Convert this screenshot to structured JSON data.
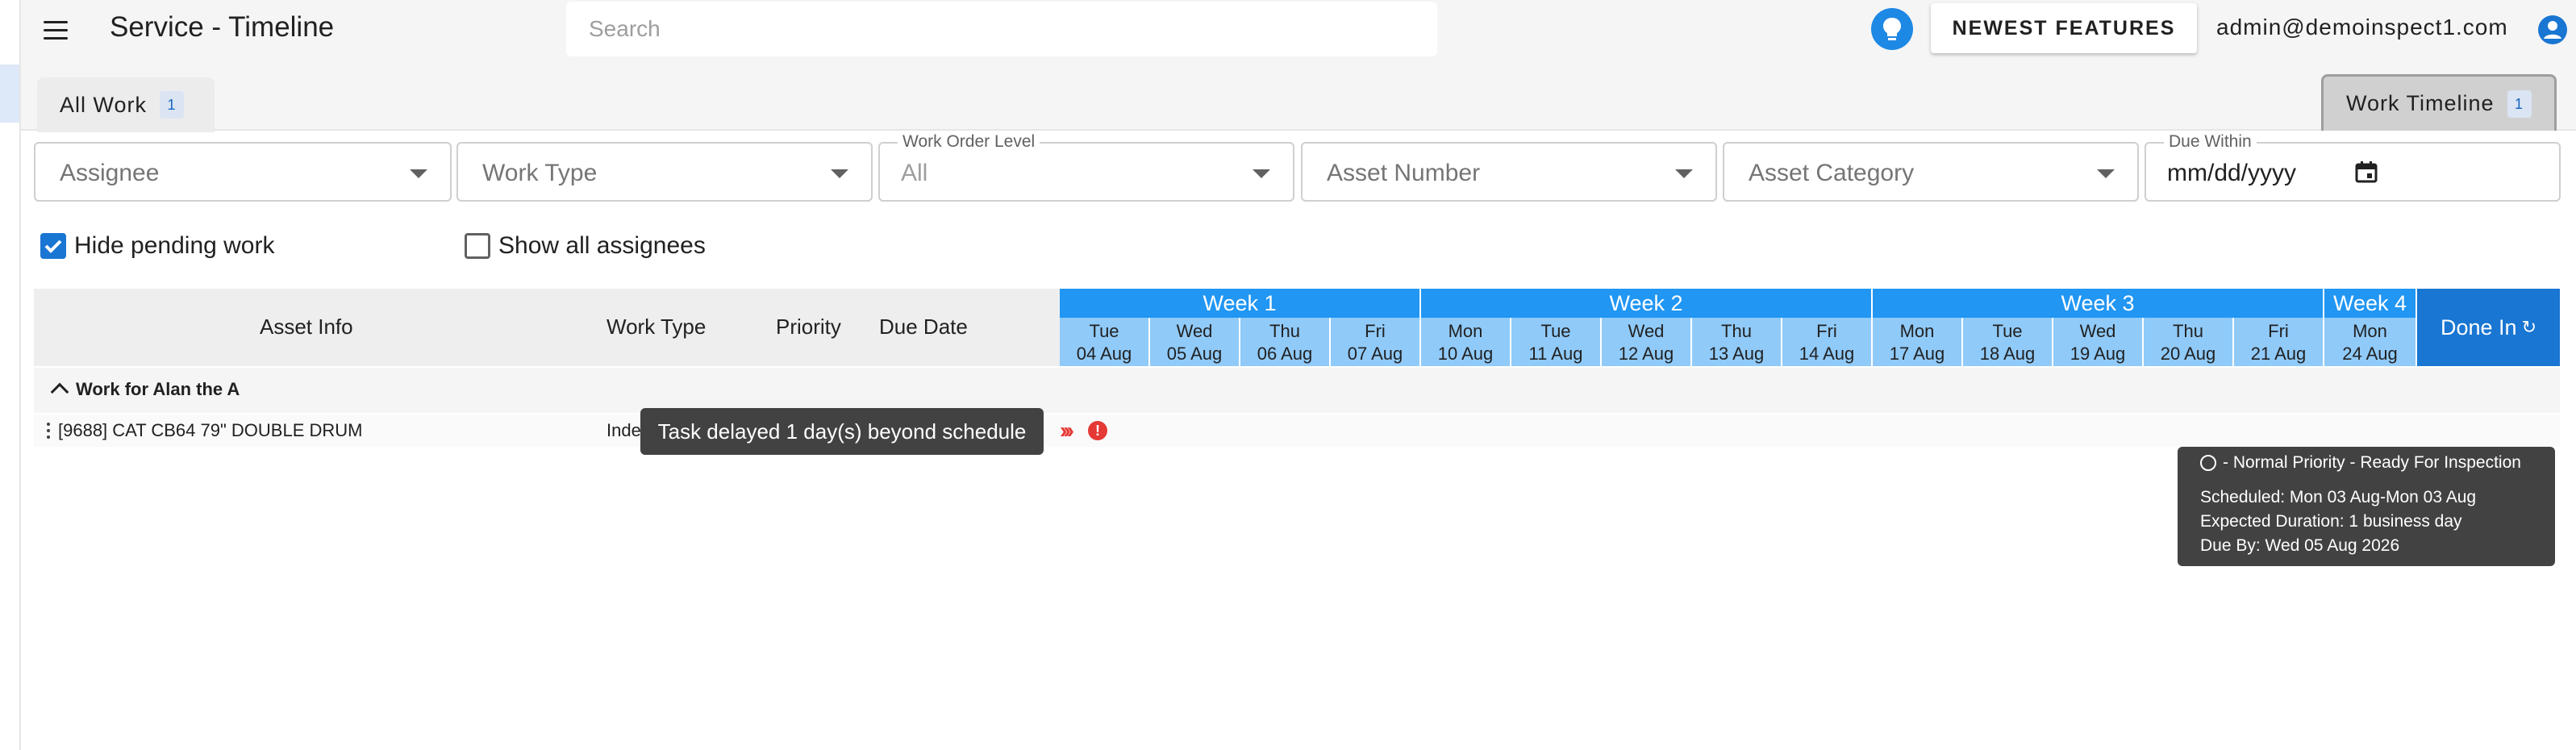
{
  "header": {
    "title": "Service - Timeline",
    "search_placeholder": "Search",
    "features_button": "NEWEST FEATURES",
    "user_email": "admin@demoinspect1.com"
  },
  "tabs": [
    {
      "label": "All Work",
      "count": "1",
      "active": false
    },
    {
      "label": "Work Timeline",
      "count": "1",
      "active": true
    }
  ],
  "filters": {
    "assignee": {
      "placeholder": "Assignee"
    },
    "work_type": {
      "placeholder": "Work Type"
    },
    "work_order_level": {
      "label": "Work Order Level",
      "value": "All"
    },
    "asset_number": {
      "placeholder": "Asset Number"
    },
    "asset_category": {
      "placeholder": "Asset Category"
    },
    "due_within": {
      "label": "Due Within",
      "value": "mm/dd/yyyy"
    }
  },
  "options": {
    "hide_pending": {
      "label": "Hide pending work",
      "checked": true
    },
    "show_all_assignees": {
      "label": "Show all assignees",
      "checked": false
    }
  },
  "grid": {
    "columns": [
      "Asset Info",
      "Work Type",
      "Priority",
      "Due Date"
    ],
    "done_in_label": "Done In",
    "weeks": [
      {
        "label": "Week 1",
        "days": [
          {
            "dow": "Tue",
            "date": "04 Aug"
          },
          {
            "dow": "Wed",
            "date": "05 Aug"
          },
          {
            "dow": "Thu",
            "date": "06 Aug"
          },
          {
            "dow": "Fri",
            "date": "07 Aug"
          }
        ]
      },
      {
        "label": "Week 2",
        "days": [
          {
            "dow": "Mon",
            "date": "10 Aug"
          },
          {
            "dow": "Tue",
            "date": "11 Aug"
          },
          {
            "dow": "Wed",
            "date": "12 Aug"
          },
          {
            "dow": "Thu",
            "date": "13 Aug"
          },
          {
            "dow": "Fri",
            "date": "14 Aug"
          }
        ]
      },
      {
        "label": "Week 3",
        "days": [
          {
            "dow": "Mon",
            "date": "17 Aug"
          },
          {
            "dow": "Tue",
            "date": "18 Aug"
          },
          {
            "dow": "Wed",
            "date": "19 Aug"
          },
          {
            "dow": "Thu",
            "date": "20 Aug"
          },
          {
            "dow": "Fri",
            "date": "21 Aug"
          }
        ]
      },
      {
        "label": "Week 4",
        "days": [
          {
            "dow": "Mon",
            "date": "24 Aug"
          }
        ]
      }
    ],
    "group_label": "Work for Alan the A",
    "row": {
      "asset": "[9688] CAT CB64 79\" DOUBLE DRUM",
      "work_type": "Inde"
    }
  },
  "tooltips": {
    "delay": "Task delayed 1 day(s) beyond schedule",
    "info": {
      "title": "- Normal Priority - Ready For Inspection",
      "scheduled": "Scheduled: Mon 03 Aug-Mon 03 Aug",
      "duration": "Expected Duration: 1 business day",
      "due": "Due By: Wed 05 Aug 2026"
    }
  },
  "colors": {
    "accent": "#1976d2",
    "week_header": "#2196f3",
    "day_header": "#90caf9",
    "alert": "#e53935"
  },
  "icons": [
    "menu-icon",
    "lightbulb-icon",
    "account-icon",
    "calendar-icon",
    "chevron-up-icon",
    "refresh-icon",
    "error-icon"
  ]
}
